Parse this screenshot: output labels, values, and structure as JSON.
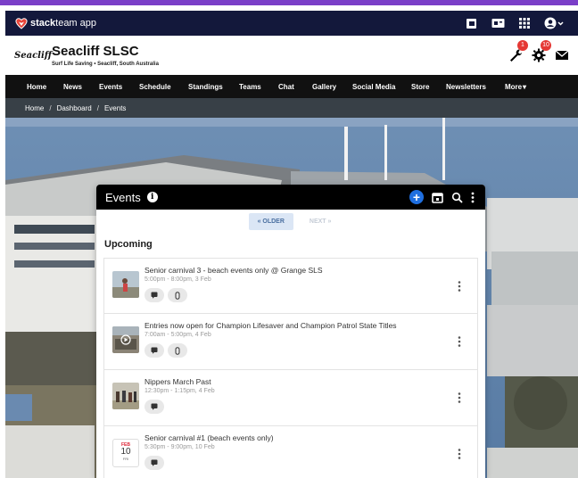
{
  "app": {
    "brand_bold": "stack",
    "brand_rest": "team app"
  },
  "club": {
    "name": "Seacliff SLSC",
    "subtitle": "Surf Life Saving • Seacliff, South Australia",
    "logo_text": "Seacliff"
  },
  "badges": {
    "tools": "1",
    "settings": "10"
  },
  "nav": [
    "Home",
    "News",
    "Events",
    "Schedule",
    "Standings",
    "Teams",
    "Chat",
    "Gallery",
    "Social Media",
    "Store",
    "Newsletters",
    "More"
  ],
  "breadcrumb": [
    "Home",
    "Dashboard",
    "Events"
  ],
  "breadcrumb_sep": "/",
  "panel": {
    "title": "Events",
    "older_label": "« OLDER",
    "newer_label": "NEXT »",
    "section_label": "Upcoming"
  },
  "events": [
    {
      "title": "Senior carnival 3 - beach events only @ Grange SLS",
      "time": "5:00pm - 8:00pm, 3 Feb",
      "thumb": "swimmer-photo"
    },
    {
      "title": "Entries now open for Champion Lifesaver and Champion Patrol State Titles",
      "time": "7:00am - 5:00pm, 4 Feb",
      "thumb": "video-photo"
    },
    {
      "title": "Nippers March Past",
      "time": "12:30pm - 1:15pm, 4 Feb",
      "thumb": "march-photo"
    },
    {
      "title": "Senior carnival #1 (beach events only)",
      "time": "5:30pm - 9:00pm, 10 Feb",
      "date_month": "FEB",
      "date_day": "10",
      "date_weekday": "FRI"
    }
  ],
  "colors": {
    "topbar": "#13183b",
    "accent": "#1f6fe0",
    "badge": "#e53935"
  }
}
